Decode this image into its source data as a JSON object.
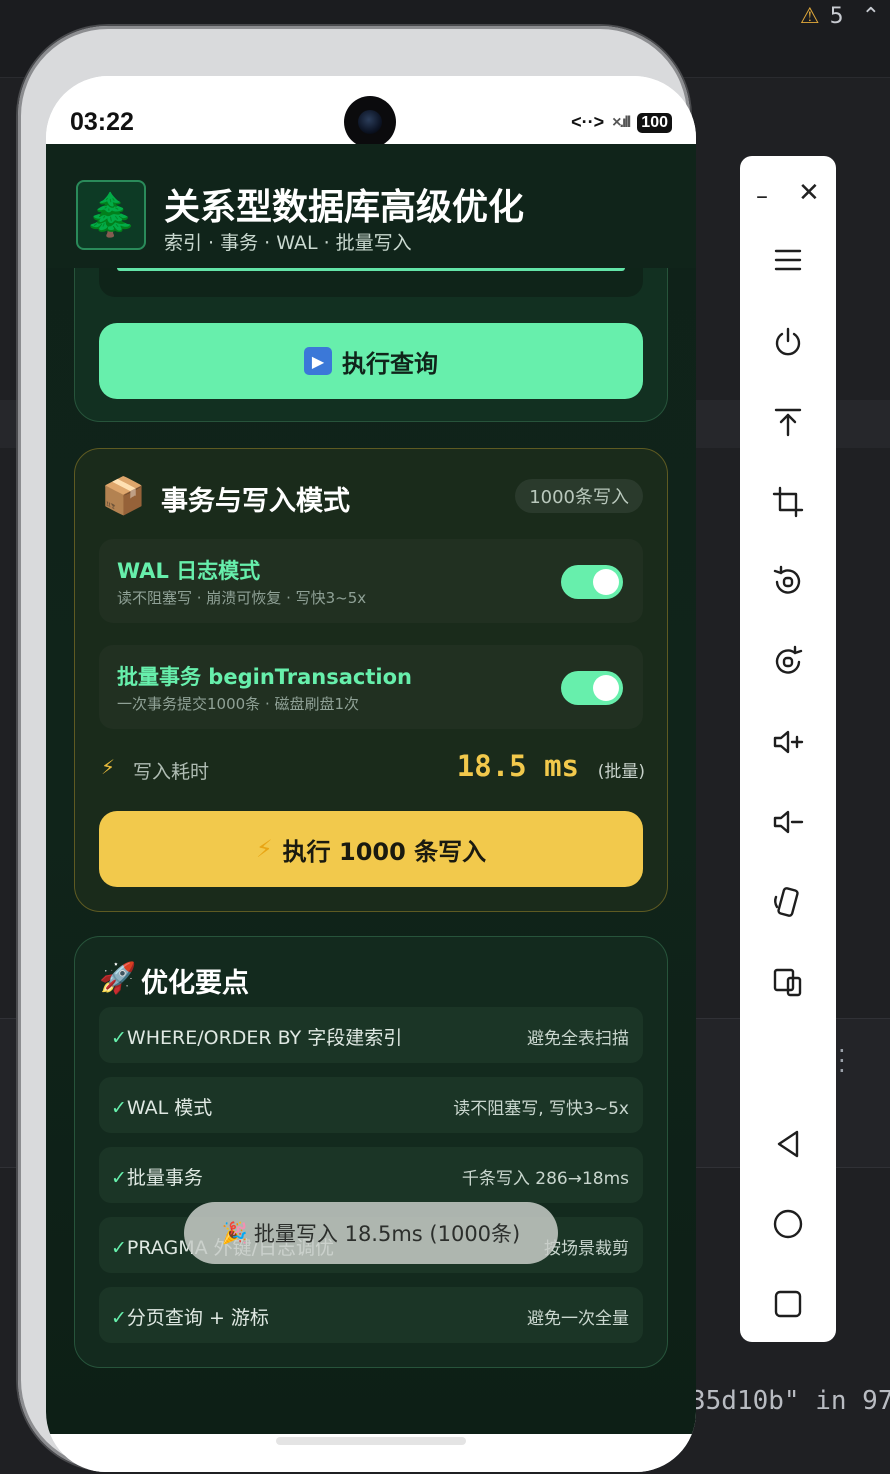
{
  "ide": {
    "warning_count": "5",
    "code_snippet": "35d10b\" in 97"
  },
  "statusbar": {
    "time": "03:22",
    "data_icon": "<··>",
    "signal_icon": "×.ıll",
    "battery": "100"
  },
  "header": {
    "logo_emoji": "🌲",
    "title": "关系型数据库高级优化",
    "subtitle": "索引 · 事务 · WAL · 批量写入"
  },
  "query_card": {
    "progress": 1.0,
    "run_button": "执行查询"
  },
  "txn_card": {
    "icon": "📦",
    "title": "事务与写入模式",
    "badge": "1000条写入",
    "options": [
      {
        "title": "WAL 日志模式",
        "desc": "读不阻塞写 · 崩溃可恢复 · 写快3~5x",
        "enabled": true
      },
      {
        "title": "批量事务 beginTransaction",
        "desc": "一次事务提交1000条 · 磁盘刷盘1次",
        "enabled": true
      }
    ],
    "latency_label": "写入耗时",
    "latency_value": "18.5 ms",
    "latency_mode": "(批量)",
    "write_button": "执行 1000 条写入"
  },
  "tips_card": {
    "icon": "🚀",
    "title": "优化要点",
    "tips": [
      {
        "left": "WHERE/ORDER BY 字段建索引",
        "right": "避免全表扫描"
      },
      {
        "left": "WAL 模式",
        "right": "读不阻塞写, 写快3~5x"
      },
      {
        "left": "批量事务",
        "right": "千条写入 286→18ms"
      },
      {
        "left": "PRAGMA 外键/日志调优",
        "right": "按场景裁剪"
      },
      {
        "left": "分页查询 + 游标",
        "right": "避免一次全量"
      }
    ]
  },
  "toast": {
    "icon": "🎉",
    "text": "批量写入 18.5ms (1000条)"
  },
  "emulator_toolbar": {
    "items": [
      "minimize-icon",
      "close-icon",
      "menu-icon",
      "power-icon",
      "upload-icon",
      "crop-icon",
      "rotate-left-icon",
      "rotate-right-icon",
      "volume-up-icon",
      "volume-down-icon",
      "fold-icon",
      "multi-display-icon",
      "back-icon",
      "home-icon",
      "overview-icon"
    ]
  }
}
